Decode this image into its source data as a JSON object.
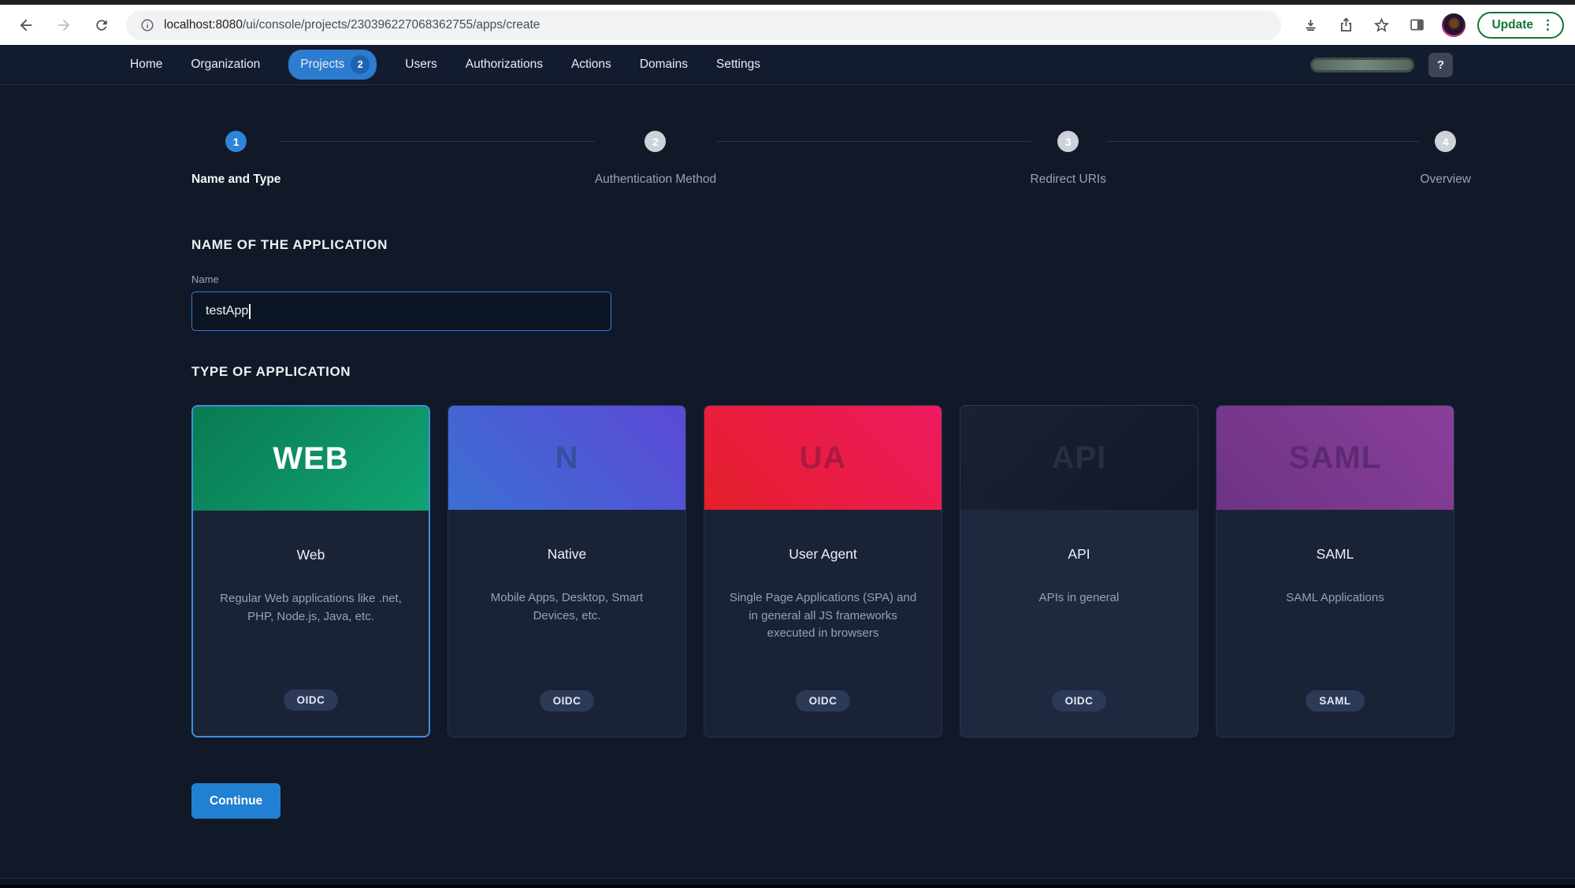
{
  "browser": {
    "url_host": "localhost:8080",
    "url_path": "/ui/console/projects/230396227068362755/apps/create",
    "update_label": "Update",
    "menu_dots": "⋮"
  },
  "nav": {
    "items": [
      {
        "label": "Home"
      },
      {
        "label": "Organization"
      },
      {
        "label": "Projects",
        "active": true,
        "badge": "2"
      },
      {
        "label": "Users"
      },
      {
        "label": "Authorizations"
      },
      {
        "label": "Actions"
      },
      {
        "label": "Domains"
      },
      {
        "label": "Settings"
      }
    ],
    "help_label": "?"
  },
  "stepper": {
    "steps": [
      {
        "num": "1",
        "label": "Name and Type",
        "active": true
      },
      {
        "num": "2",
        "label": "Authentication Method",
        "active": false
      },
      {
        "num": "3",
        "label": "Redirect URIs",
        "active": false
      },
      {
        "num": "4",
        "label": "Overview",
        "active": false
      }
    ]
  },
  "form": {
    "name_section_title": "NAME OF THE APPLICATION",
    "name_label": "Name",
    "name_value": "testApp",
    "type_section_title": "TYPE OF APPLICATION"
  },
  "app_types": [
    {
      "id": "web",
      "banner_label": "WEB",
      "banner_colors": [
        "#0a7a52",
        "#10a472"
      ],
      "banner_angle": 135,
      "banner_label_color": "#ffffff",
      "title": "Web",
      "description": "Regular Web applications like .net, PHP, Node.js, Java, etc.",
      "protocol_badge": "OIDC",
      "selected": true
    },
    {
      "id": "native",
      "banner_label": "N",
      "banner_colors": [
        "#3a70d3",
        "#5d48d6"
      ],
      "banner_angle": 45,
      "banner_label_color": "#35509c",
      "title": "Native",
      "description": "Mobile Apps, Desktop, Smart Devices, etc.",
      "protocol_badge": "OIDC",
      "selected": false
    },
    {
      "id": "user-agent",
      "banner_label": "UA",
      "banner_colors": [
        "#e5202a",
        "#ee1960"
      ],
      "banner_angle": 45,
      "banner_label_color": "#ab1a41",
      "title": "User Agent",
      "description": "Single Page Applications (SPA) and in general all JS frameworks executed in browsers",
      "protocol_badge": "OIDC",
      "selected": false
    },
    {
      "id": "api",
      "banner_label": "API",
      "banner_colors": [
        "#1a2232",
        "#121827"
      ],
      "banner_angle": 135,
      "banner_label_color": "#262f43",
      "title": "API",
      "description": "APIs in general",
      "protocol_badge": "OIDC",
      "selected": false,
      "body_color": "#1e2940",
      "border_color": "#2b3753"
    },
    {
      "id": "saml",
      "banner_label": "SAML",
      "banner_colors": [
        "#6d3384",
        "#8a3f9b"
      ],
      "banner_angle": 45,
      "banner_label_color": "#5d2a72",
      "title": "SAML",
      "description": "SAML Applications",
      "protocol_badge": "SAML",
      "selected": false
    }
  ],
  "actions": {
    "continue_label": "Continue"
  }
}
